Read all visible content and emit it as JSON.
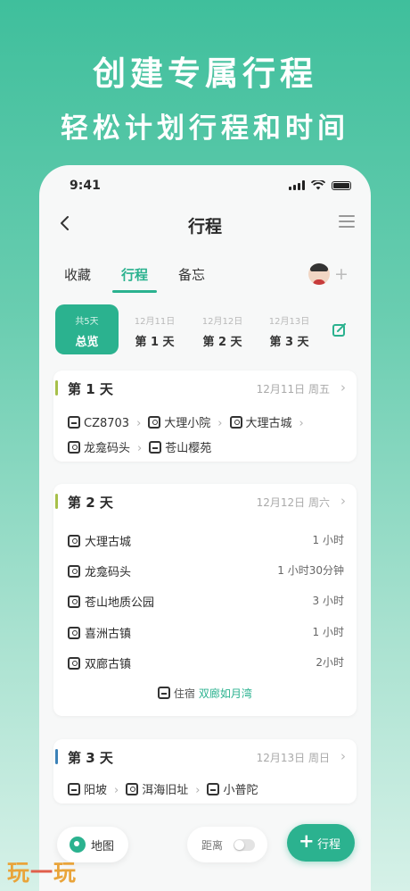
{
  "hero": {
    "title": "创建专属行程",
    "subtitle": "轻松计划行程和时间"
  },
  "status_bar": {
    "time": "9:41"
  },
  "navbar": {
    "title": "行程"
  },
  "tabs": [
    {
      "label": "收藏",
      "active": false
    },
    {
      "label": "行程",
      "active": true
    },
    {
      "label": "备忘",
      "active": false
    }
  ],
  "day_chips": [
    {
      "small": "共5天",
      "big": "总览",
      "active": true
    },
    {
      "small": "12月11日",
      "big": "第 1 天",
      "active": false
    },
    {
      "small": "12月12日",
      "big": "第 2 天",
      "active": false
    },
    {
      "small": "12月13日",
      "big": "第 3 天",
      "active": false
    }
  ],
  "days": [
    {
      "label": "第 1 天",
      "date": "12月11日 周五",
      "accent": "#a7c04a",
      "route": [
        {
          "name": "CZ8703",
          "icon": "train-icon"
        },
        {
          "name": "大理小院",
          "icon": "place-icon"
        },
        {
          "name": "大理古城",
          "icon": "place-icon"
        },
        {
          "name": "龙龛码头",
          "icon": "place-icon"
        },
        {
          "name": "苍山樱苑",
          "icon": "scenic-icon"
        }
      ]
    },
    {
      "label": "第 2 天",
      "date": "12月12日 周六",
      "accent": "#a7c04a",
      "items": [
        {
          "name": "大理古城",
          "duration": "1 小时"
        },
        {
          "name": "龙龛码头",
          "duration": "1 小时30分钟"
        },
        {
          "name": "苍山地质公园",
          "duration": "3 小时"
        },
        {
          "name": "喜洲古镇",
          "duration": "1 小时"
        },
        {
          "name": "双廊古镇",
          "duration": "2小时"
        }
      ],
      "stay": {
        "prefix": "住宿",
        "hotel": "双廊如月湾"
      }
    },
    {
      "label": "第 3 天",
      "date": "12月13日 周日",
      "accent": "#3b82b8",
      "route": [
        {
          "name": "阳坡",
          "icon": "scenic-icon"
        },
        {
          "name": "洱海旧址",
          "icon": "place-icon"
        },
        {
          "name": "小普陀",
          "icon": "scenic-icon"
        }
      ]
    }
  ],
  "bottom_bar": {
    "map_label": "地图",
    "distance_label": "距离",
    "add_label": "行程"
  },
  "watermark": {
    "part1": "玩",
    "dash": "一",
    "part2": "玩"
  },
  "colors": {
    "accent": "#2bb28f",
    "hero_bg": "#3fbf9c"
  }
}
